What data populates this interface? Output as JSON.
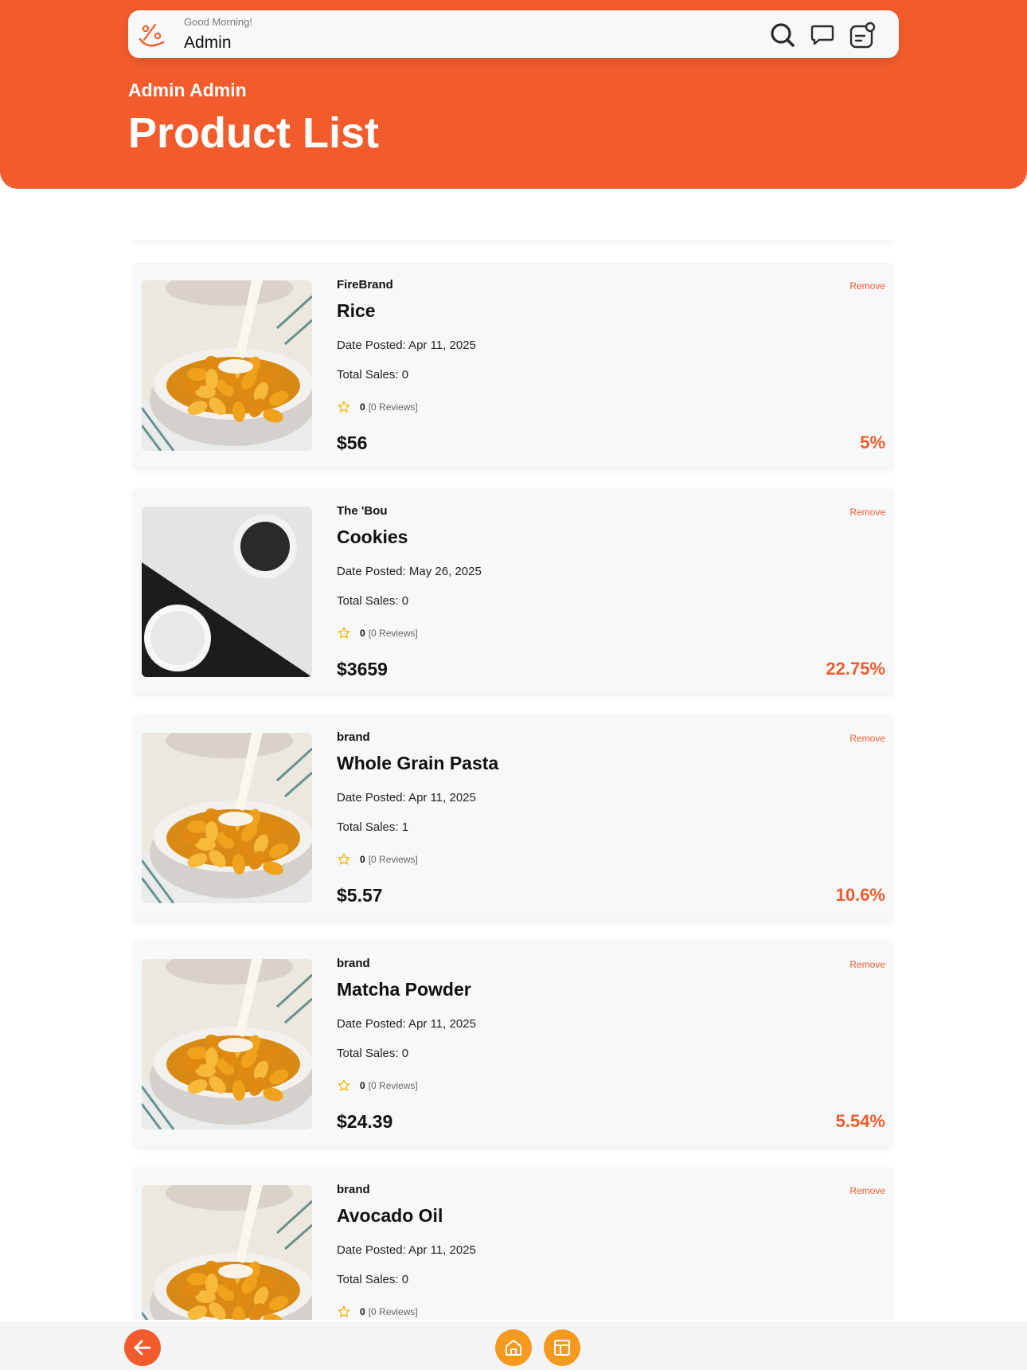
{
  "header": {
    "greeting": "Good Morning!",
    "user_name": "Admin",
    "account_name": "Admin Admin",
    "page_title": "Product List"
  },
  "products": [
    {
      "brand": "FireBrand",
      "name": "Rice",
      "date_posted": "Date Posted: Apr 11, 2025",
      "total_sales": "Total Sales: 0",
      "rating": "0",
      "reviews": "[0 Reviews]",
      "price": "$56",
      "percent": "5%",
      "remove_label": "Remove",
      "image": "cereal-bowl"
    },
    {
      "brand": "The 'Bou",
      "name": "Cookies",
      "date_posted": "Date Posted: May 26, 2025",
      "total_sales": "Total Sales: 0",
      "rating": "0",
      "reviews": "[0 Reviews]",
      "price": "$3659",
      "percent": "22.75%",
      "remove_label": "Remove",
      "image": "coffee-beans"
    },
    {
      "brand": "brand",
      "name": "Whole Grain Pasta",
      "date_posted": "Date Posted: Apr 11, 2025",
      "total_sales": "Total Sales: 1",
      "rating": "0",
      "reviews": "[0 Reviews]",
      "price": "$5.57",
      "percent": "10.6%",
      "remove_label": "Remove",
      "image": "cereal-bowl"
    },
    {
      "brand": "brand",
      "name": "Matcha Powder",
      "date_posted": "Date Posted: Apr 11, 2025",
      "total_sales": "Total Sales: 0",
      "rating": "0",
      "reviews": "[0 Reviews]",
      "price": "$24.39",
      "percent": "5.54%",
      "remove_label": "Remove",
      "image": "cereal-bowl"
    },
    {
      "brand": "brand",
      "name": "Avocado Oil",
      "date_posted": "Date Posted: Apr 11, 2025",
      "total_sales": "Total Sales: 0",
      "rating": "0",
      "reviews": "[0 Reviews]",
      "price": "",
      "percent": "",
      "remove_label": "Remove",
      "image": "cereal-bowl"
    }
  ],
  "icons": {
    "logo": "discount-logo-icon",
    "search": "search-icon",
    "chat": "chat-icon",
    "notes": "notes-icon",
    "star": "star-outline-icon",
    "back": "arrow-left-icon",
    "home": "home-icon",
    "layout": "layout-icon"
  },
  "colors": {
    "accent": "#f25c2d",
    "nav_button": "#f59a1f",
    "star": "#f4b400",
    "card_bg": "#f7f8fa"
  }
}
